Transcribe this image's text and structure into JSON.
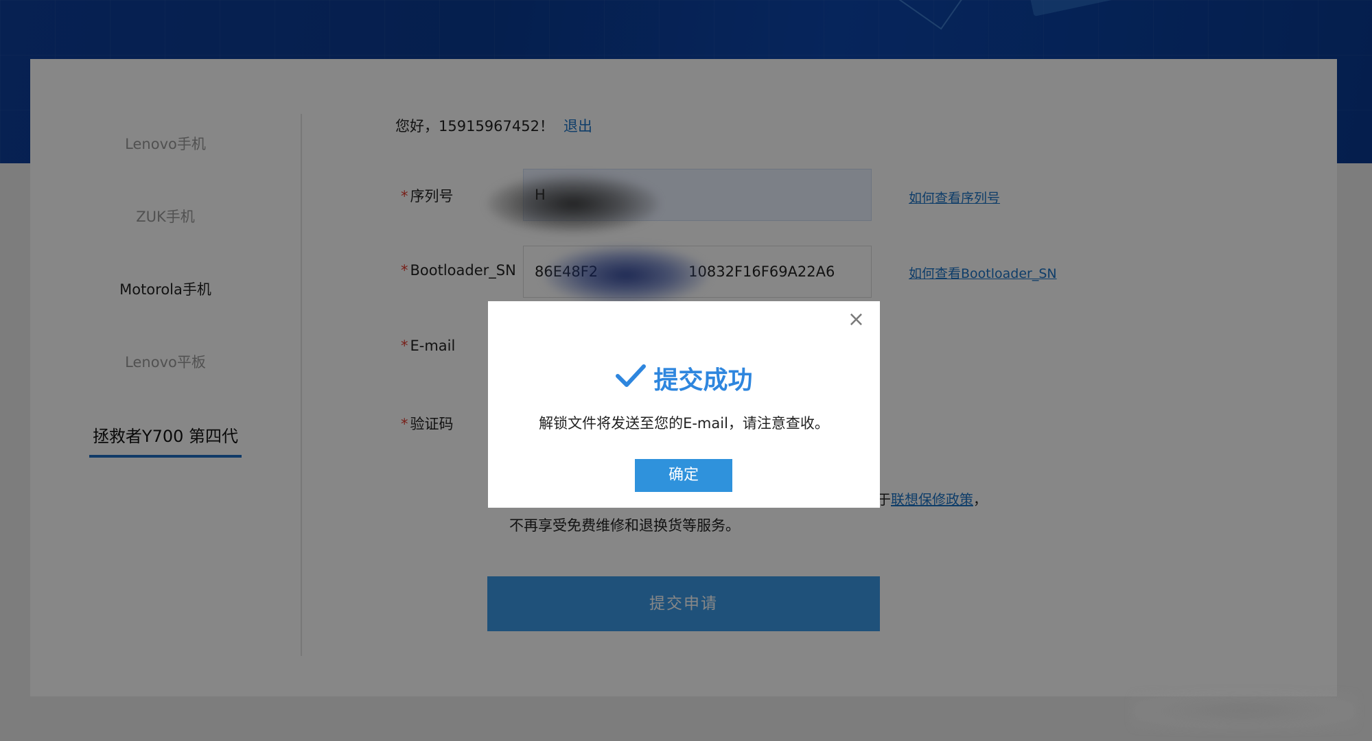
{
  "sidebar": {
    "items": [
      {
        "label": "Lenovo手机"
      },
      {
        "label": "ZUK手机"
      },
      {
        "label": "Motorola手机"
      },
      {
        "label": "Lenovo平板"
      },
      {
        "label": "拯救者Y700 第四代"
      }
    ]
  },
  "header": {
    "greeting": "您好，15915967452！",
    "logout": "退出"
  },
  "form": {
    "serial": {
      "label": "序列号",
      "value": "H",
      "help": "如何查看序列号"
    },
    "bootloader": {
      "label": "Bootloader_SN",
      "value": "86E48F2",
      "value_tail": "10832F16F69A22A6",
      "help": "如何查看Bootloader_SN"
    },
    "email": {
      "label": "E-mail"
    },
    "captcha": {
      "label": "验证码"
    },
    "notice_line1_tail": "于",
    "notice_link": "联想保修政策",
    "notice_line1_end": "，",
    "notice_line2": "不再享受免费维修和退换货等服务。",
    "required_mark": "*",
    "submit": "提交申请"
  },
  "modal": {
    "title": "提交成功",
    "message": "解锁文件将发送至您的E-mail，请注意查收。",
    "ok": "确定",
    "close": "×"
  },
  "colors": {
    "accent": "#2e86de",
    "link": "#1b73c7",
    "required": "#e23b2f",
    "banner": "#0e3f9c"
  }
}
